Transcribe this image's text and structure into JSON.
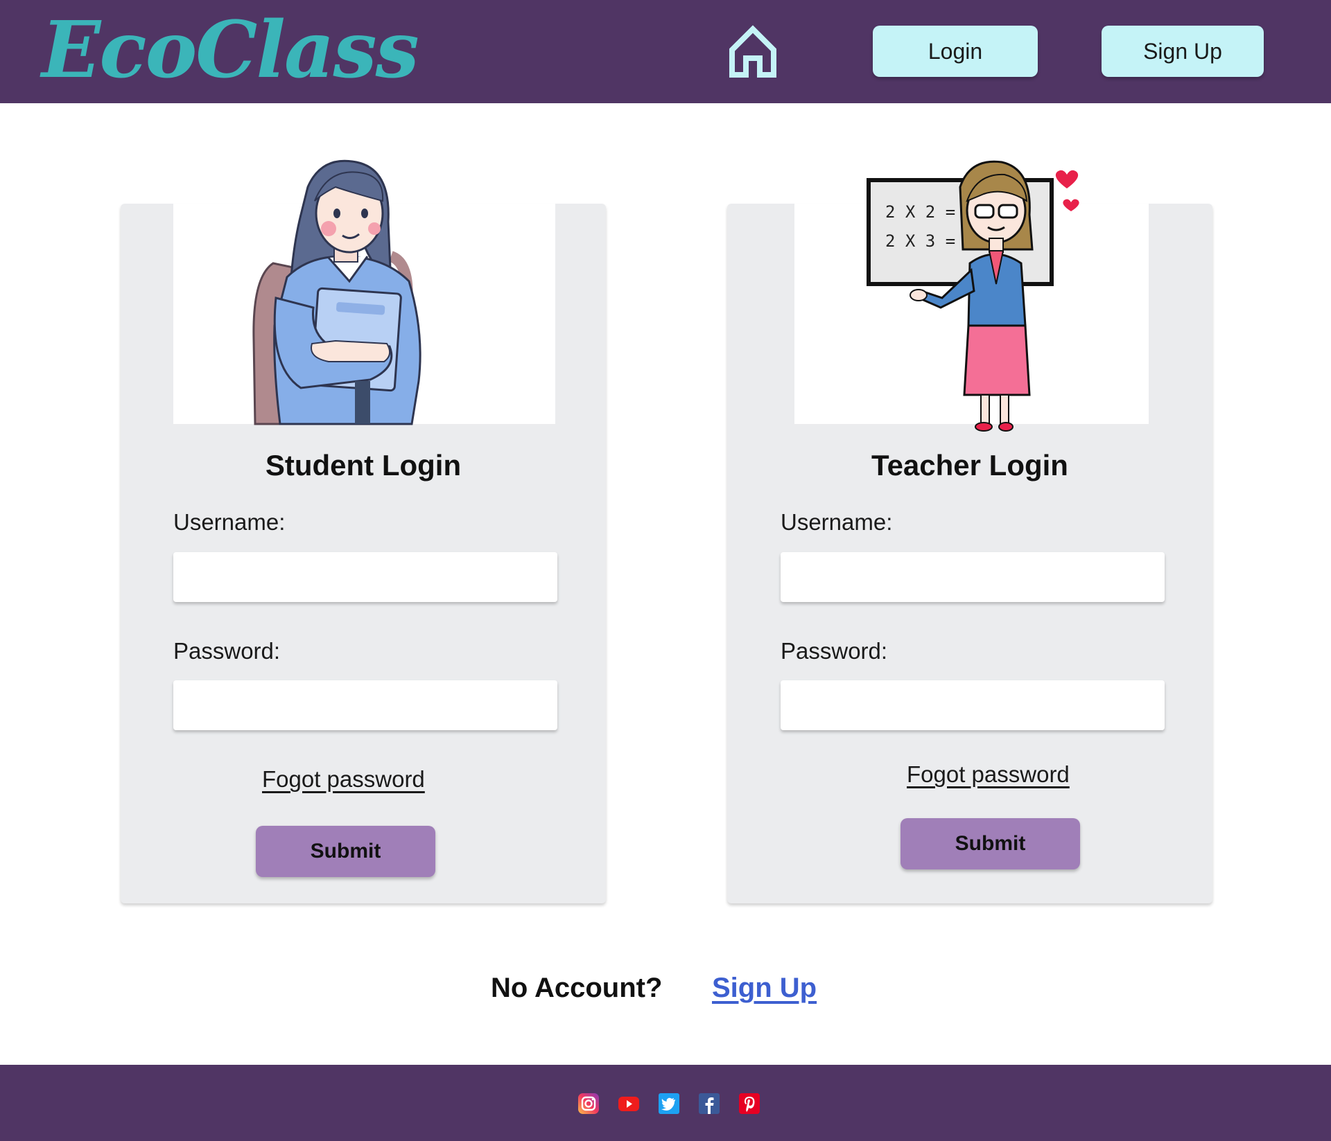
{
  "header": {
    "logo": "EcoClass",
    "nav": {
      "login_label": "Login",
      "signup_label": "Sign Up"
    }
  },
  "student_card": {
    "title": "Student Login",
    "username_label": "Username:",
    "password_label": "Password:",
    "username_value": "",
    "password_value": "",
    "forgot_label": "Fogot password",
    "submit_label": "Submit"
  },
  "teacher_card": {
    "title": "Teacher Login",
    "username_label": "Username:",
    "password_label": "Password:",
    "username_value": "",
    "password_value": "",
    "forgot_label": "Fogot password",
    "submit_label": "Submit",
    "board_line1": "2 X 2 = 4",
    "board_line2": "2 X 3 = ?"
  },
  "no_account": {
    "prompt": "No Account?",
    "signup_label": "Sign Up"
  },
  "footer": {
    "social_icons": [
      "instagram-icon",
      "youtube-icon",
      "twitter-icon",
      "facebook-icon",
      "pinterest-icon"
    ]
  },
  "colors": {
    "header_bg": "#503564",
    "logo": "#3bb5b9",
    "nav_button": "#c5f3f7",
    "card_bg": "#ebecee",
    "submit_button": "#a07fb8",
    "signup_link": "#3d5fd0"
  }
}
